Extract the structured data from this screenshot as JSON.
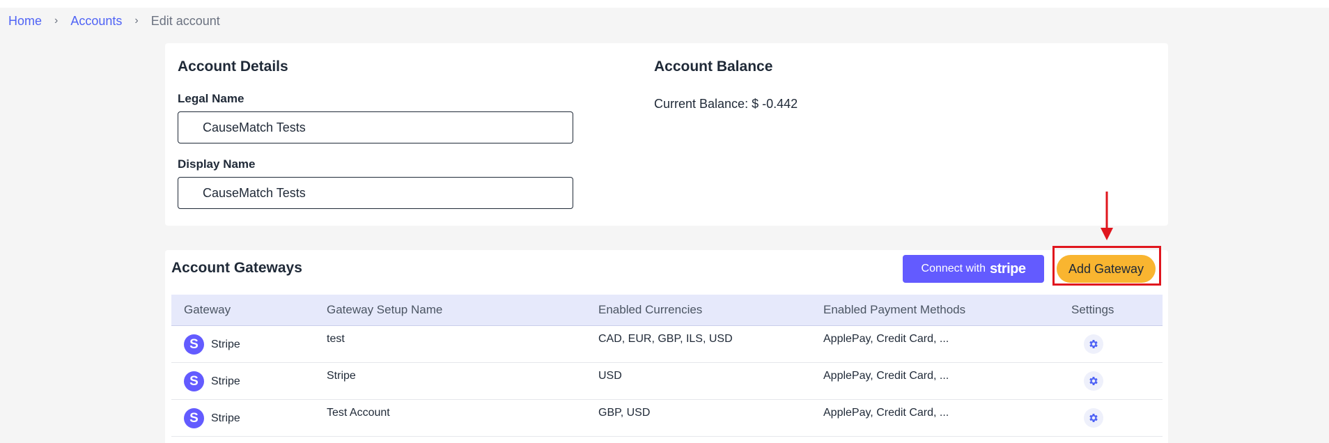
{
  "breadcrumb": {
    "home": "Home",
    "accounts": "Accounts",
    "current": "Edit account",
    "separator": "›"
  },
  "account_details": {
    "title": "Account Details",
    "legal_name_label": "Legal Name",
    "legal_name_value": "CauseMatch Tests",
    "display_name_label": "Display Name",
    "display_name_value": "CauseMatch Tests"
  },
  "account_balance": {
    "title": "Account Balance",
    "current_balance": "Current Balance: $ -0.442"
  },
  "gateways": {
    "title": "Account Gateways",
    "connect_stripe_prefix": "Connect with",
    "connect_stripe_brand": "stripe",
    "add_gateway_label": "Add Gateway",
    "columns": {
      "gateway": "Gateway",
      "setup_name": "Gateway Setup Name",
      "currencies": "Enabled Currencies",
      "payment_methods": "Enabled Payment Methods",
      "settings": "Settings"
    },
    "rows": [
      {
        "gateway": "Stripe",
        "logo_letter": "S",
        "setup_name": "test",
        "currencies": "CAD, EUR, GBP, ILS, USD",
        "payment_methods": "ApplePay, Credit Card, ..."
      },
      {
        "gateway": "Stripe",
        "logo_letter": "S",
        "setup_name": "Stripe",
        "currencies": "USD",
        "payment_methods": "ApplePay, Credit Card, ..."
      },
      {
        "gateway": "Stripe",
        "logo_letter": "S",
        "setup_name": "Test Account",
        "currencies": "GBP, USD",
        "payment_methods": "ApplePay, Credit Card, ..."
      }
    ]
  },
  "colors": {
    "link": "#4f63f5",
    "stripe_brand": "#635bff",
    "add_gateway": "#f9b530",
    "annotation_red": "#e0161e",
    "table_header_bg": "#e6e9fb"
  },
  "icons": {
    "breadcrumb_separator": "chevron-right-icon",
    "settings": "gear-icon",
    "gateway_logo": "stripe-logo-icon",
    "annotation": "arrow-down-icon"
  }
}
